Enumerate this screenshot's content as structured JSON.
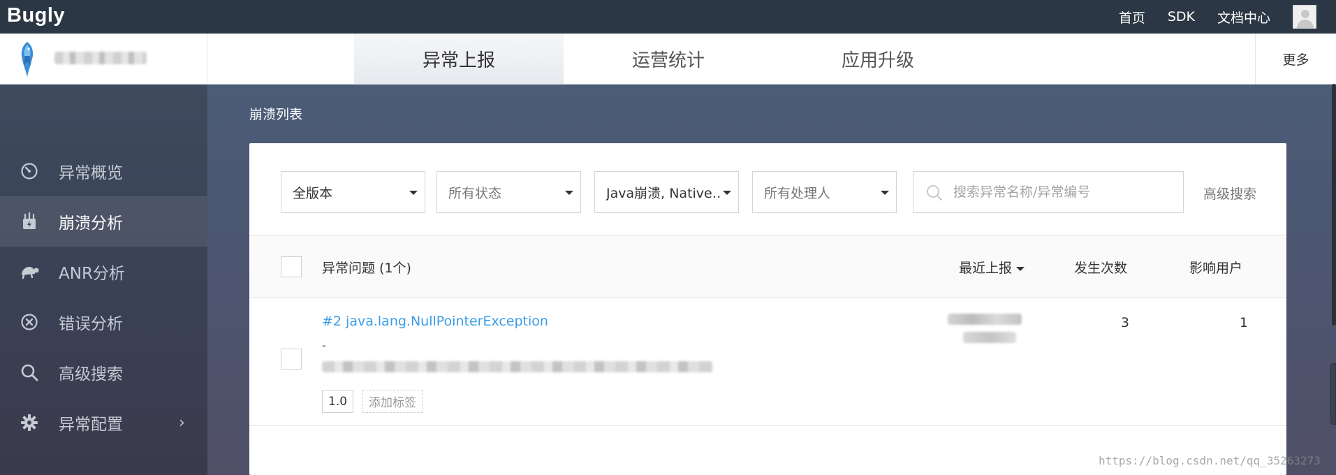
{
  "topbar": {
    "brand": "Bugly",
    "nav": [
      "首页",
      "SDK",
      "文档中心"
    ]
  },
  "subheader": {
    "tabs": [
      {
        "label": "异常上报",
        "active": true
      },
      {
        "label": "运营统计",
        "active": false
      },
      {
        "label": "应用升级",
        "active": false
      }
    ],
    "more": "更多"
  },
  "sidebar": {
    "items": [
      {
        "label": "异常概览",
        "icon": "gauge-icon",
        "active": false
      },
      {
        "label": "崩溃分析",
        "icon": "crash-icon",
        "active": true
      },
      {
        "label": "ANR分析",
        "icon": "turtle-icon",
        "active": false
      },
      {
        "label": "错误分析",
        "icon": "error-circle-icon",
        "active": false
      },
      {
        "label": "高级搜索",
        "icon": "search-icon",
        "active": false
      },
      {
        "label": "异常配置",
        "icon": "gear-icon",
        "active": false,
        "has_submenu": true
      }
    ]
  },
  "main": {
    "title": "崩溃列表",
    "filters": {
      "version": "全版本",
      "status": "所有状态",
      "type": "Java崩溃, Native…",
      "handler": "所有处理人",
      "search_placeholder": "搜索异常名称/异常编号",
      "advanced": "高级搜索"
    },
    "table": {
      "columns": {
        "issue": "异常问题 (1个)",
        "latest": "最近上报",
        "count": "发生次数",
        "users": "影响用户"
      },
      "rows": [
        {
          "title": "#2 java.lang.NullPointerException",
          "dash": "-",
          "version_tag": "1.0",
          "add_tag": "添加标签",
          "count": "3",
          "users": "1"
        }
      ]
    }
  },
  "watermark": "https://blog.csdn.net/qq_35263273",
  "colors": {
    "topbar": "#2b3744",
    "sidebar": "#3e4b5d",
    "link": "#3a9ce6"
  }
}
